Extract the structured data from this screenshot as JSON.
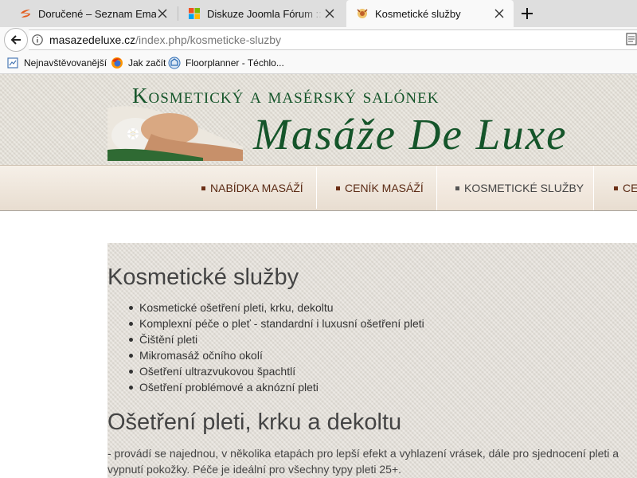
{
  "browser": {
    "tabs": [
      {
        "title": "Doručené – Seznam Email",
        "favicon": "seznam-icon"
      },
      {
        "title": "Diskuze Joomla Fórum :: Téma",
        "favicon": "windows-icon"
      },
      {
        "title": "Kosmetické služby",
        "favicon": "site-favicon",
        "active": true
      }
    ],
    "url_domain": "masazedeluxe.cz",
    "url_path": "/index.php/kosmeticke-sluzby",
    "bookmarks": [
      {
        "label": "Nejnavštěvovanější",
        "icon": "bookmark-page-icon"
      },
      {
        "label": "Jak začít",
        "icon": "firefox-icon"
      },
      {
        "label": "Floorplanner - Téchlo...",
        "icon": "floorplanner-icon"
      }
    ]
  },
  "site": {
    "logo_top": "Kosmetický a masérský salónek",
    "logo_script": "Masáže De Luxe",
    "menu": [
      {
        "label": "NABÍDKA MASÁŽÍ",
        "active": false
      },
      {
        "label": "CENÍK MASÁŽÍ",
        "active": false
      },
      {
        "label": "KOSMETICKÉ SLUŽBY",
        "active": true
      },
      {
        "label": "CE",
        "active": false
      }
    ],
    "heading": "Kosmetické služby",
    "services": [
      "Kosmetické ošetření pleti, krku, dekoltu",
      "Komplexní péče o pleť - standardní i luxusní ošetření pleti",
      "Čištění pleti",
      "Mikromasáž očního okolí",
      "Ošetření ultrazvukovou špachtlí",
      "Ošetření problémové a aknózní pleti"
    ],
    "subheading": "Ošetření pleti, krku a dekoltu",
    "paragraph": "- provádí se najednou, v několika etapách pro lepší efekt a vyhlazení vrásek, dále pro sjednocení pleti a vypnutí pokožky. Péče je ideální pro všechny typy pleti 25+."
  },
  "colors": {
    "logo_green": "#15552a",
    "menu_text": "#5a2a14",
    "content_bg": "#e4e0d9"
  }
}
